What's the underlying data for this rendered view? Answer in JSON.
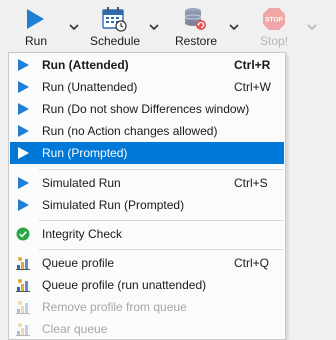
{
  "toolbar": {
    "run_label": "Run",
    "schedule_label": "Schedule",
    "restore_label": "Restore",
    "stop_label": "Stop!",
    "stop_icon_text": "STOP"
  },
  "menu": {
    "items": [
      {
        "label": "Run (Attended)",
        "shortcut": "Ctrl+R",
        "bold": true,
        "icon": "play-icon"
      },
      {
        "label": "Run (Unattended)",
        "shortcut": "Ctrl+W",
        "icon": "play-icon"
      },
      {
        "label": "Run (Do not show Differences window)",
        "shortcut": "",
        "icon": "play-icon"
      },
      {
        "label": "Run (no Action changes allowed)",
        "shortcut": "",
        "icon": "play-icon"
      },
      {
        "label": "Run (Prompted)",
        "shortcut": "",
        "highlighted": true,
        "icon": "play-icon"
      },
      {
        "label": "Simulated Run",
        "shortcut": "Ctrl+S",
        "icon": "play-icon"
      },
      {
        "label": "Simulated Run (Prompted)",
        "shortcut": "",
        "icon": "play-icon"
      },
      {
        "label": "Integrity Check",
        "shortcut": "",
        "icon": "check-circle-icon"
      },
      {
        "label": "Queue profile",
        "shortcut": "Ctrl+Q",
        "icon": "queue-icon"
      },
      {
        "label": "Queue profile (run unattended)",
        "shortcut": "",
        "icon": "queue-icon"
      },
      {
        "label": "Remove profile from queue",
        "shortcut": "",
        "disabled": true,
        "icon": "queue-icon"
      },
      {
        "label": "Clear queue",
        "shortcut": "",
        "disabled": true,
        "icon": "queue-icon"
      }
    ]
  },
  "colors": {
    "accent": "#0078d7",
    "play": "#1e7fd4",
    "check": "#2aa845",
    "stop_disabled": "#f0a6a6"
  }
}
